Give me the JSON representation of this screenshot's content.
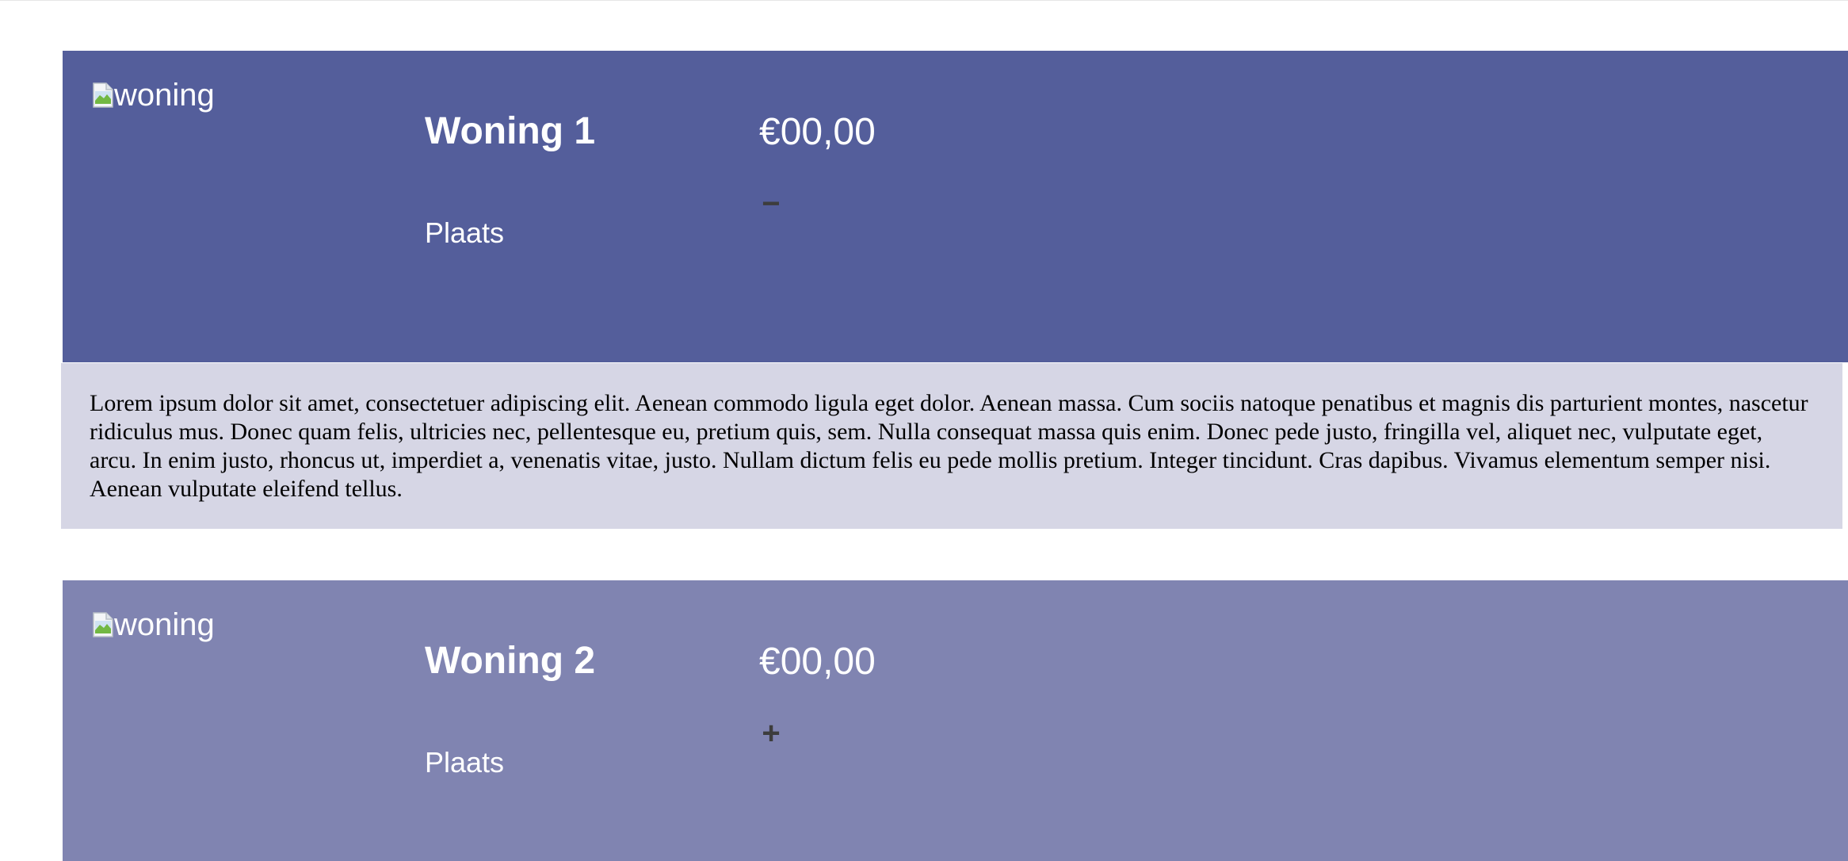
{
  "listings": [
    {
      "image_alt": "woning",
      "title": "Woning 1",
      "place": "Plaats",
      "price": "€00,00",
      "toggle": "−",
      "expanded": true,
      "description": "Lorem ipsum dolor sit amet, consectetuer adipiscing elit. Aenean commodo ligula eget dolor. Aenean massa. Cum sociis natoque penatibus et magnis dis parturient montes, nascetur ridiculus mus. Donec quam felis, ultricies nec, pellentesque eu, pretium quis, sem. Nulla consequat massa quis enim. Donec pede justo, fringilla vel, aliquet nec, vulputate eget, arcu. In enim justo, rhoncus ut, imperdiet a, venenatis vitae, justo. Nullam dictum felis eu pede mollis pretium. Integer tincidunt. Cras dapibus. Vivamus elementum semper nisi. Aenean vulputate eleifend tellus."
    },
    {
      "image_alt": "woning",
      "title": "Woning 2",
      "place": "Plaats",
      "price": "€00,00",
      "toggle": "+",
      "expanded": false
    }
  ],
  "colors": {
    "card_expanded": "#545e9b",
    "card_collapsed": "#8084b1",
    "description_bg": "#d6d6e5",
    "toggle_color": "#3d3d3d"
  },
  "icons": {
    "image": "broken-image-icon"
  }
}
